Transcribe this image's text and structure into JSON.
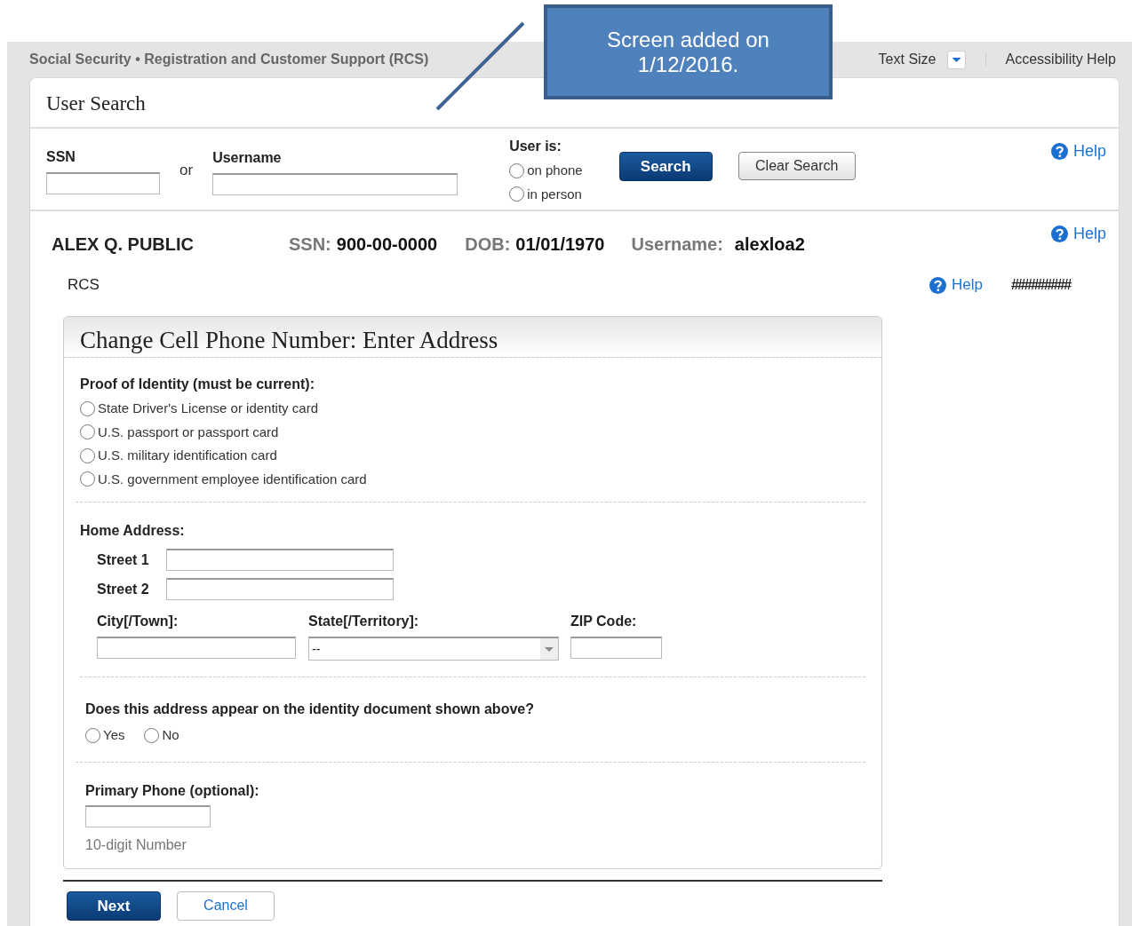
{
  "callout": {
    "text": "Screen added on 1/12/2016."
  },
  "header": {
    "title": "Social Security • Registration and Customer Support (RCS)",
    "text_size": "Text Size",
    "accessibility": "Accessibility Help"
  },
  "user_search": {
    "title": "User Search",
    "ssn_label": "SSN",
    "or": "or",
    "username_label": "Username",
    "user_is_label": "User is:",
    "user_is_options": [
      {
        "label": "on phone",
        "selected": false
      },
      {
        "label": "in person",
        "selected": false
      }
    ],
    "search_button": "Search",
    "clear_button": "Clear Search",
    "help": "Help"
  },
  "user": {
    "name": "ALEX Q. PUBLIC",
    "fields": [
      {
        "label": "SSN:",
        "value": "900-00-0000"
      },
      {
        "label": "DOB:",
        "value": "01/01/1970"
      },
      {
        "label": "Username:",
        "value": "alexloa2"
      }
    ],
    "help": "Help"
  },
  "breadcrumb": "RCS",
  "help": "Help",
  "masked": "#########",
  "form": {
    "title": "Change Cell Phone Number: Enter Address",
    "proof_label": "Proof of Identity (must be current):",
    "proof_options": [
      {
        "label": "State Driver's License or identity card",
        "selected": false
      },
      {
        "label": "U.S. passport or passport card",
        "selected": false
      },
      {
        "label": "U.S. military identification card",
        "selected": false
      },
      {
        "label": "U.S. government employee identification card",
        "selected": false
      }
    ],
    "home_label": "Home Address:",
    "street1_label": "Street 1",
    "street2_label": "Street 2",
    "city_label": "City[/Town]:",
    "state_label": "State[/Territory]:",
    "state_value": "--",
    "zip_label": "ZIP Code:",
    "question": "Does this address appear on the identity document shown above?",
    "answers": [
      {
        "label": "Yes",
        "selected": false
      },
      {
        "label": "No",
        "selected": false
      }
    ],
    "phone_label": "Primary Phone (optional):",
    "phone_hint": "10-digit Number"
  },
  "buttons": {
    "next": "Next",
    "cancel": "Cancel"
  }
}
